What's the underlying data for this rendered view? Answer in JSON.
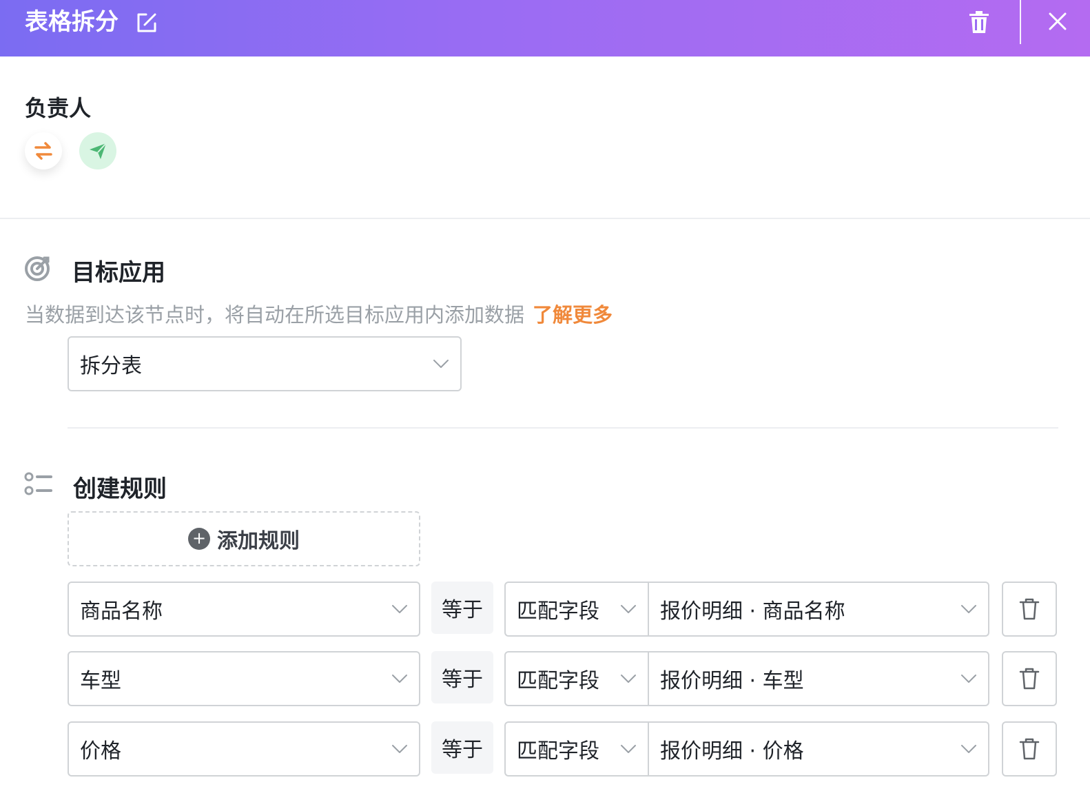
{
  "header": {
    "title": "表格拆分",
    "edit_icon": "edit-icon",
    "delete_icon": "trash-icon",
    "close_icon": "close-icon"
  },
  "owner": {
    "label": "负责人",
    "switch_icon": "swap-icon",
    "send_icon": "send-icon"
  },
  "target_app": {
    "title": "目标应用",
    "description": "当数据到达该节点时，将自动在所选目标应用内添加数据",
    "learn_more": "了解更多",
    "selected": "拆分表"
  },
  "rules": {
    "title": "创建规则",
    "add_label": "添加规则",
    "items": [
      {
        "field": "商品名称",
        "operator": "等于",
        "match_type": "匹配字段",
        "value": "报价明细 · 商品名称"
      },
      {
        "field": "车型",
        "operator": "等于",
        "match_type": "匹配字段",
        "value": "报价明细 · 车型"
      },
      {
        "field": "价格",
        "operator": "等于",
        "match_type": "匹配字段",
        "value": "报价明细 · 价格"
      }
    ]
  },
  "colors": {
    "header_gradient_start": "#7b6cf2",
    "header_gradient_end": "#b46bf1",
    "accent_orange": "#f0893b",
    "send_green": "#4cb774"
  }
}
